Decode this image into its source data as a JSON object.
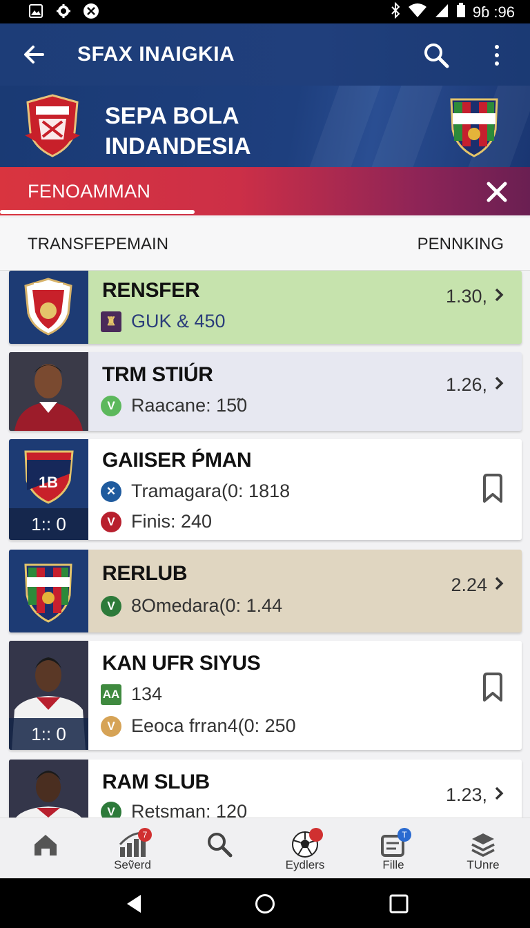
{
  "status_bar": {
    "time": "9ɓ :96",
    "icons": [
      "gallery-icon",
      "settings-icon",
      "no-signal-icon",
      "bluetooth-icon",
      "wifi-icon",
      "signal-icon",
      "battery-icon"
    ]
  },
  "app_bar": {
    "title": "SFAX INAIGKIA",
    "icons": [
      "back-arrow-icon",
      "search-icon",
      "more-vertical-icon"
    ]
  },
  "banner": {
    "title_line1": "SEPA BOLA",
    "title_line2": "INDANDESIA"
  },
  "section": {
    "label": "FENOAMMAN"
  },
  "tabs": {
    "left": "TRANSFEPEMAIN",
    "right": "PENNKING"
  },
  "items": [
    {
      "name": "RENSFER",
      "line1": "GUK & 450",
      "line1_badge": "club",
      "value": "1.30,",
      "bg": "#c6e3ad"
    },
    {
      "name": "TRM STIÚR",
      "line1": "Raacane: 15̃0",
      "line1_badge": "v",
      "value": "1.26,",
      "bg": "#e7e8f1"
    },
    {
      "name": "GAIISER ṔMAN",
      "line1": "Tramagara(0: 1818",
      "line2": "Finis: 240",
      "score": "1:: 0",
      "bg": "#ffffff"
    },
    {
      "name": "RERLUB",
      "line1": "8Omedara(0: 1.44",
      "line1_badge": "v",
      "value": "2.24",
      "bg": "#e0d6c1"
    },
    {
      "name": "KAN UFR SIYUS",
      "line1": "134",
      "line2": "Eeoca frran4(0:  250",
      "score": "1:: 0",
      "bg": "#ffffff"
    },
    {
      "name": "RAM SLUB",
      "line1": "Retsman: 120",
      "line1_badge": "v",
      "value": "1.23,",
      "bg": "#ffffff"
    }
  ],
  "bottom_nav": [
    {
      "label": "",
      "icon": "home-icon"
    },
    {
      "label": "Seṽerd",
      "icon": "stats-icon",
      "badge": "7"
    },
    {
      "label": "",
      "icon": "search-icon"
    },
    {
      "label": "Eydlers",
      "icon": "soccer-ball-icon",
      "badge": ""
    },
    {
      "label": "Fille",
      "icon": "news-icon",
      "badge": "T"
    },
    {
      "label": "TUnre",
      "icon": "layers-icon"
    }
  ],
  "colors": {
    "app_bar": "#1d3d78",
    "section_bar_start": "#d9343f",
    "section_bar_end": "#6a1f52",
    "badge_green": "#5cb85c",
    "badge_red": "#b8202e",
    "badge_blue": "#1f5b9e",
    "badge_gold": "#d6a356"
  }
}
